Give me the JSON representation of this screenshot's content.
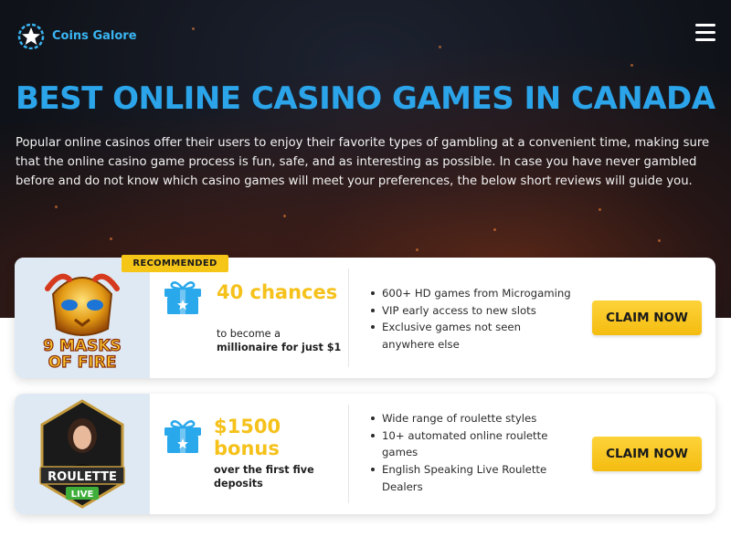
{
  "brand": {
    "name": "Coins Galore",
    "logo_icon": "star-coin-icon",
    "accent_color": "#2ba4ea"
  },
  "header": {
    "menu_icon": "hamburger-menu-icon"
  },
  "hero": {
    "title": "BEST ONLINE CASINO GAMES IN CANADA",
    "intro": "Popular online casinos offer their users to enjoy their favorite types of gambling at a convenient time, making sure that the online casino game process is fun, safe, and as interesting as possible. In case you have never gambled before and do not know which casino games will meet your preferences, the below short reviews will guide you."
  },
  "offers": [
    {
      "badge": "RECOMMENDED",
      "game_logo_text": [
        "9 MASKS",
        "OF FIRE"
      ],
      "icon": "gift-box-icon",
      "bonus_amount": "40 chances",
      "bonus_desc_line1": "to become a",
      "bonus_desc_line2": "millionaire for just $1",
      "features": [
        "600+ HD games from Microgaming",
        "VIP early access to new slots",
        "Exclusive games not seen anywhere else"
      ],
      "cta": "CLAIM NOW"
    },
    {
      "game_logo_text": [
        "ROULETTE",
        "LIVE"
      ],
      "icon": "gift-box-icon",
      "bonus_amount": "$1500 bonus",
      "bonus_desc_line1": "over the first five",
      "bonus_desc_line2": "deposits",
      "features": [
        "Wide range of roulette styles",
        "10+ automated online roulette games",
        "English Speaking Live Roulette Dealers"
      ],
      "cta": "CLAIM NOW"
    }
  ]
}
